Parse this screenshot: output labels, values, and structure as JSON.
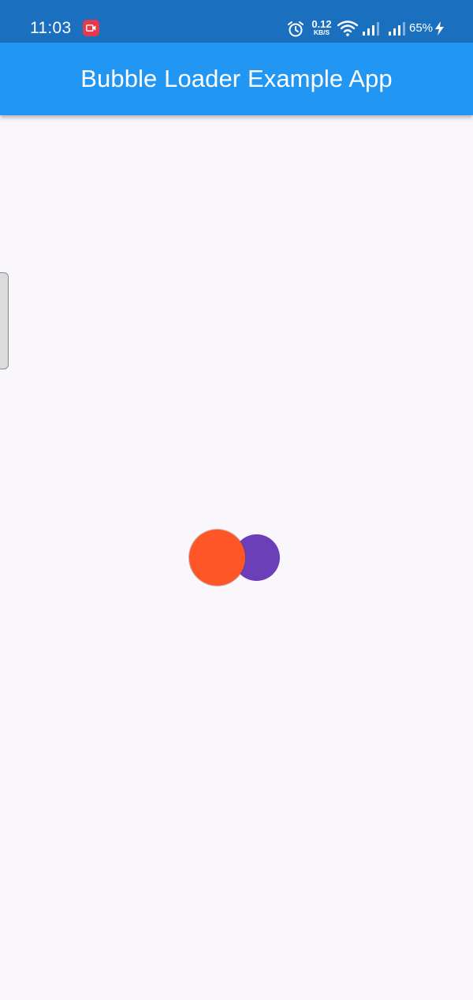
{
  "status_bar": {
    "time": "11:03",
    "net_speed_value": "0.12",
    "net_speed_unit": "KB/S",
    "battery": "65%",
    "icons": [
      "screen-record-icon",
      "alarm-icon",
      "wifi-icon",
      "signal-icon",
      "signal-icon",
      "charging-icon"
    ]
  },
  "app_bar": {
    "title": "Bubble Loader Example App"
  },
  "loader": {
    "bubble_colors": [
      "#ff5627",
      "#6b3fb8"
    ]
  },
  "colors": {
    "status_bar": "#1a70bf",
    "app_bar": "#2196f3",
    "background": "#f9f7fb"
  }
}
